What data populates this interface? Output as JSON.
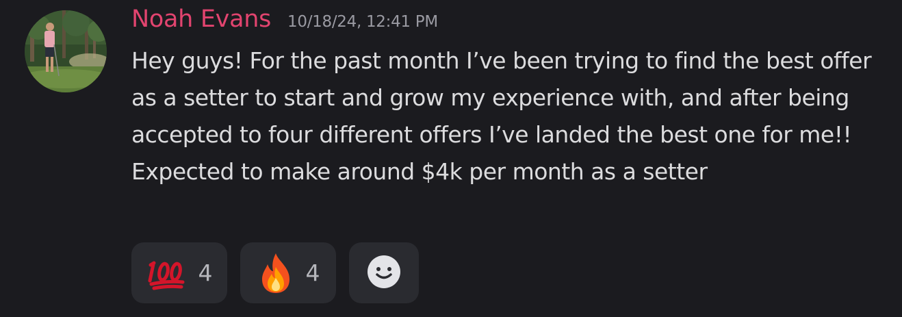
{
  "message": {
    "author": "Noah Evans",
    "timestamp": "10/18/24, 12:41 PM",
    "text": "Hey guys! For the past month I’ve been trying to find the best offer as a setter to start and grow my experience with, and after being accepted to four different offers  I’ve landed the best one for me!! Expected to make around $4k per month as a setter",
    "author_color": "#e2446f"
  },
  "reactions": [
    {
      "emoji": "hundred-points-icon",
      "count": "4"
    },
    {
      "emoji": "fire-icon",
      "count": "4"
    }
  ],
  "add_reaction": {
    "icon": "smiley-icon"
  }
}
